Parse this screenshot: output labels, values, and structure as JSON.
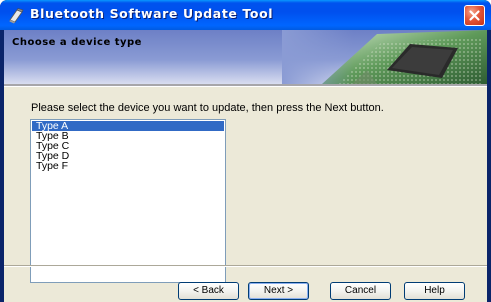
{
  "window": {
    "title": "Bluetooth Software Update Tool"
  },
  "header": {
    "title": "Choose a device type"
  },
  "main": {
    "instruction": "Please select the device you want to update, then press the Next button.",
    "device_list": {
      "items": [
        "Type A",
        "Type B",
        "Type C",
        "Type D",
        "Type F"
      ],
      "selected": "Type A"
    }
  },
  "buttons": {
    "back": "< Back",
    "next": "Next >",
    "cancel": "Cancel",
    "help": "Help"
  },
  "icons": {
    "title_icon": "bluetooth-tool-icon",
    "close": "close-icon",
    "header_art": "circuit-chip-image"
  },
  "colors": {
    "titlebar": "#0058ee",
    "dialog_bg": "#ece9d8",
    "header_band": "#8a9bd4",
    "selection": "#316ac5",
    "close_button": "#e2563a"
  }
}
